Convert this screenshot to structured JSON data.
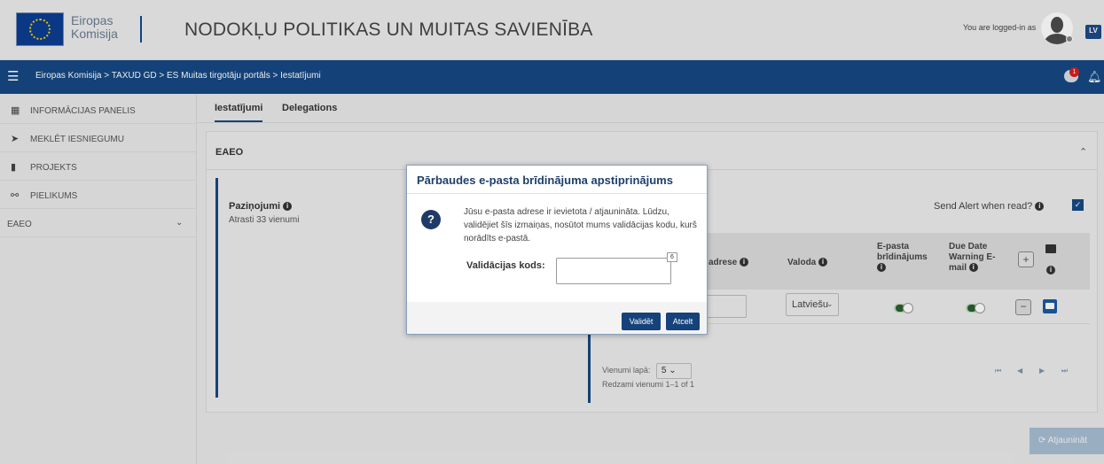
{
  "header": {
    "logo_line1": "Eiropas",
    "logo_line2": "Komisija",
    "site_title": "NODOKĻU POLITIKAS UN MUITAS SAVIENĪBA",
    "logged_in": "You are logged-in as",
    "lang": "LV"
  },
  "nav": {
    "breadcrumb": "Eiropas Komisija > TAXUD GD > ES Muitas tirgotāju portāls > Iestatījumi",
    "chat_badge": "1"
  },
  "sidebar": {
    "items": [
      {
        "label": "INFORMĀCIJAS PANELIS"
      },
      {
        "label": "MEKLĒT IESNIEGUMU"
      },
      {
        "label": "PROJEKTS"
      },
      {
        "label": "PIELIKUMS"
      },
      {
        "label": "EAEO"
      }
    ]
  },
  "tabs": [
    {
      "label": "Iestatījumi"
    },
    {
      "label": "Delegations"
    }
  ],
  "card": {
    "title": "EAEO",
    "notifications_title": "Paziņojumi",
    "notifications_count": "Atrasti 33 vienumi",
    "send_alert": "Send Alert when read?",
    "columns": {
      "address": "adrese",
      "language": "Valoda",
      "email_alerts_1": "E-pasta",
      "email_alerts_2": "brīdinājums",
      "due_date_1": "Due Date",
      "due_date_2": "Warning E-",
      "due_date_3": "mail"
    },
    "row": {
      "email_value": "er",
      "language": "Latviešu"
    },
    "per_page_label": "Vienumi lapā:",
    "per_page_value": "5",
    "showing": "Redzami vienumi 1–1 of 1"
  },
  "refresh_label": "Atjaunināt",
  "modal": {
    "title": "Pārbaudes e-pasta brīdinājuma apstiprinājums",
    "message": "Jūsu e-pasta adrese ir ievietota / atjaunināta. Lūdzu, validējiet šīs izmaiņas, nosūtot mums validācijas kodu, kurš norādīts e-pastā.",
    "code_label": "Validācijas kods:",
    "counter": "6",
    "validate_label": "Validēt",
    "cancel_label": "Atcelt"
  },
  "colors": {
    "brand": "#164883",
    "modal_title": "#1f3f6b"
  }
}
